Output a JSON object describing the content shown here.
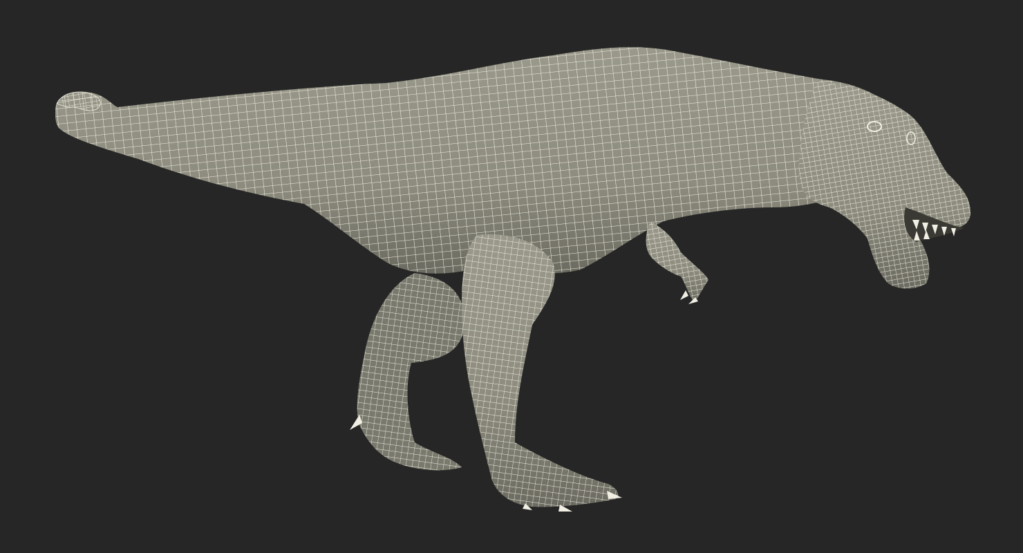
{
  "scene": {
    "subject": "tyrannosaurus-wireframe-model",
    "render_style": "wireframe-over-clay",
    "colors": {
      "background": "#262626",
      "surface": "#8d8c7e",
      "surface_shadow": "#76756a",
      "surface_dark": "#5f5e55",
      "wire": "#f3f1e6",
      "teeth": "#f1efe4"
    }
  }
}
